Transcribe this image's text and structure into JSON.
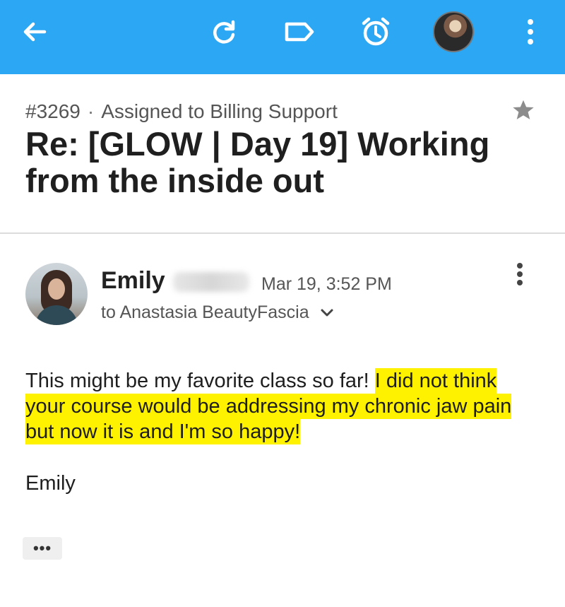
{
  "toolbar": {
    "back_icon": "arrow-left-icon",
    "refresh_icon": "refresh-icon",
    "label_icon": "label-tag-icon",
    "snooze_icon": "alarm-clock-icon",
    "overflow_icon": "vertical-dots-icon",
    "accent_color": "#2ba7f3"
  },
  "ticket": {
    "number": "#3269",
    "separator": "·",
    "assignment": "Assigned to Billing Support",
    "subject": "Re: [GLOW | Day 19] Working from the inside out"
  },
  "message": {
    "sender_first_name": "Emily",
    "date": "Mar 19, 3:52 PM",
    "to_prefix": "to",
    "recipient": "Anastasia BeautyFascia",
    "body_plain": "This might be my favorite class so far! ",
    "body_highlighted": "I did not think your course would be addressing my chronic jaw pain but now it is and I'm so happy!",
    "signature": "Emily",
    "show_more_label": "•••",
    "highlight_color": "#fff200"
  }
}
